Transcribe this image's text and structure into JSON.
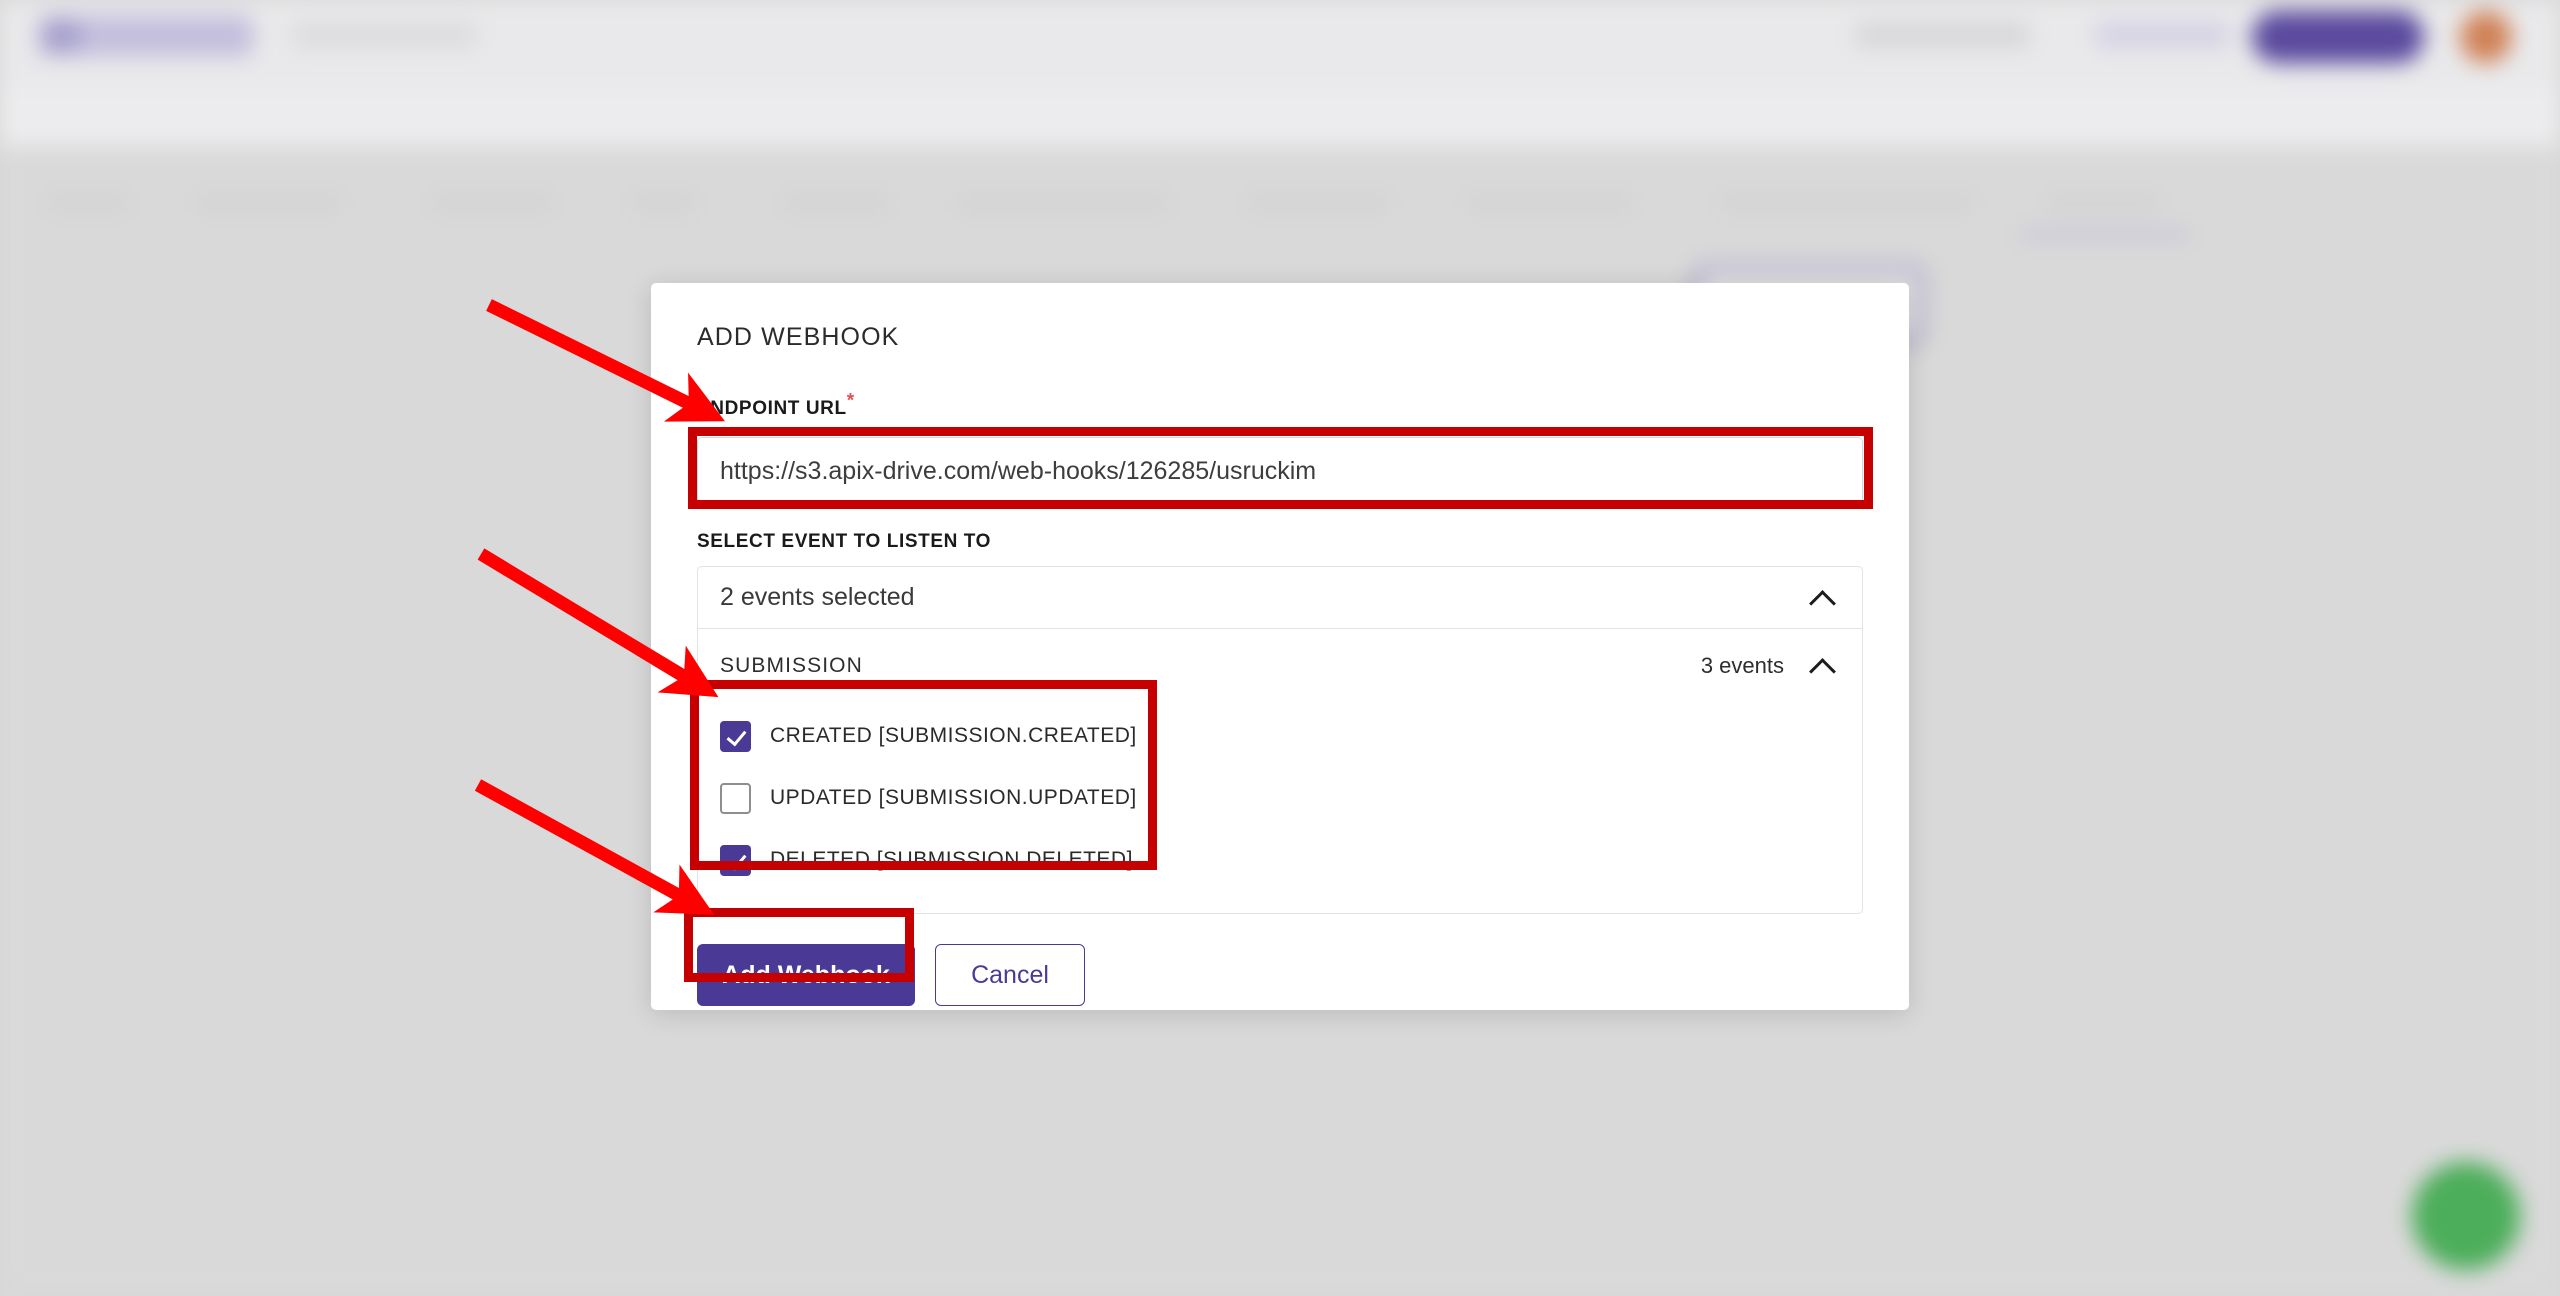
{
  "background": {
    "description": "Blurred Jotform-like form builder page behind modal",
    "accent_purple": "#4a3a96",
    "avatar_color": "#d08257",
    "chat_fab_color": "#4cae5a",
    "page_bg": "#d9d9d9"
  },
  "modal": {
    "title": "ADD WEBHOOK",
    "endpoint": {
      "label": "ENDPOINT URL",
      "required_marker": "*",
      "value": "https://s3.apix-drive.com/web-hooks/126285/usruckim",
      "placeholder": "https://"
    },
    "event_select": {
      "label": "SELECT EVENT TO LISTEN TO",
      "summary": "2 events selected",
      "chevron": "chevron-up-icon",
      "groups": [
        {
          "name": "SUBMISSION",
          "count_label": "3 events",
          "chevron": "chevron-up-icon",
          "events": [
            {
              "label": "CREATED [SUBMISSION.CREATED]",
              "checked": true
            },
            {
              "label": "UPDATED [SUBMISSION.UPDATED]",
              "checked": false
            },
            {
              "label": "DELETED [SUBMISSION.DELETED]",
              "checked": true
            }
          ]
        }
      ]
    },
    "actions": {
      "submit_label": "Add Webhook",
      "cancel_label": "Cancel"
    }
  },
  "annotations": {
    "color": "#c60000",
    "arrow_color": "#ff0000",
    "boxes": [
      {
        "name": "endpoint-url-highlight"
      },
      {
        "name": "events-checkbox-highlight"
      },
      {
        "name": "add-webhook-button-highlight"
      }
    ],
    "arrows": [
      {
        "name": "arrow-to-endpoint-url"
      },
      {
        "name": "arrow-to-submission-events"
      },
      {
        "name": "arrow-to-add-webhook-button"
      }
    ]
  }
}
